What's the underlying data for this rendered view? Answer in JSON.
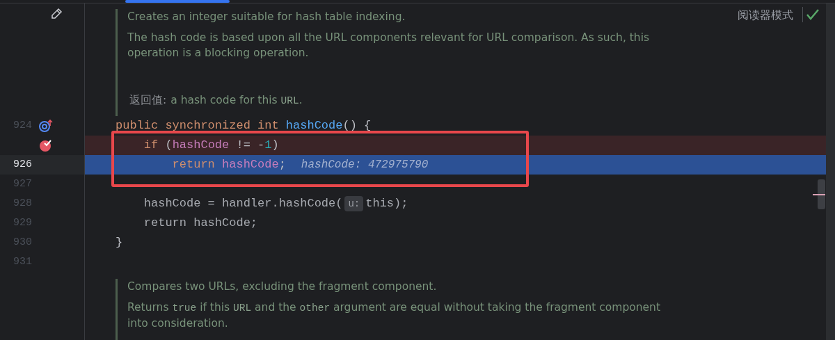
{
  "reader_mode": {
    "label": "阅读器模式"
  },
  "doc_top": {
    "paragraphs": [
      [
        {
          "text": "Creates an integer suitable for hash table indexing.",
          "code": false
        }
      ],
      [
        {
          "text": "The hash code is based upon all the URL components relevant for URL comparison. As such, this operation is a blocking operation.",
          "code": false
        }
      ]
    ],
    "return_label": "返回值:",
    "return_text": [
      {
        "text": "a hash code for this ",
        "code": false
      },
      {
        "text": "URL",
        "code": true
      },
      {
        "text": ".",
        "code": false
      }
    ]
  },
  "code_lines": [
    {
      "number": "924",
      "override_marker": true,
      "breakpoint": false,
      "execution_point": false,
      "tokens": [
        {
          "text": "public synchronized int ",
          "kind": "keyword"
        },
        {
          "text": "hashCode",
          "kind": "method"
        },
        {
          "text": "() {",
          "kind": "plain"
        }
      ]
    },
    {
      "override_marker": false,
      "breakpoint": true,
      "execution_point": false,
      "tokens": [
        {
          "text": "    if",
          "kind": "keyword"
        },
        {
          "text": " (",
          "kind": "plain"
        },
        {
          "text": "hashCode",
          "kind": "field"
        },
        {
          "text": " != -",
          "kind": "plain"
        },
        {
          "text": "1",
          "kind": "number"
        },
        {
          "text": ")",
          "kind": "plain"
        }
      ]
    },
    {
      "number": "926",
      "override_marker": false,
      "breakpoint": false,
      "execution_point": true,
      "tokens": [
        {
          "text": "        return ",
          "kind": "keyword"
        },
        {
          "text": "hashCode",
          "kind": "field"
        },
        {
          "text": ";",
          "kind": "plain"
        }
      ],
      "inline_value": "hashCode: 472975790"
    },
    {
      "number": "927",
      "override_marker": false,
      "breakpoint": false,
      "execution_point": false
    },
    {
      "number": "928",
      "override_marker": false,
      "breakpoint": false,
      "execution_point": false,
      "tokens": [
        {
          "text": "    hashCode = handler.hashCode(",
          "kind": "dim"
        },
        {
          "text": "u:",
          "kind": "param"
        },
        {
          "text": "this);",
          "kind": "dim"
        }
      ]
    },
    {
      "number": "929",
      "override_marker": false,
      "breakpoint": false,
      "execution_point": false,
      "tokens": [
        {
          "text": "    return hashCode;",
          "kind": "dim"
        }
      ]
    },
    {
      "number": "930",
      "override_marker": false,
      "breakpoint": false,
      "execution_point": false,
      "tokens": [
        {
          "text": "}",
          "kind": "plain"
        }
      ]
    },
    {
      "number": "931",
      "override_marker": false,
      "breakpoint": false,
      "execution_point": false
    }
  ],
  "doc_bottom": {
    "paragraphs": [
      [
        {
          "text": "Compares two URLs, excluding the fragment component.",
          "code": false
        }
      ],
      [
        {
          "text": "Returns ",
          "code": false
        },
        {
          "text": "true",
          "code": true
        },
        {
          "text": " if this ",
          "code": false
        },
        {
          "text": "URL",
          "code": true
        },
        {
          "text": " and the ",
          "code": false
        },
        {
          "text": "other",
          "code": true
        },
        {
          "text": " argument are equal without taking the fragment component into consideration.",
          "code": false
        }
      ]
    ]
  }
}
